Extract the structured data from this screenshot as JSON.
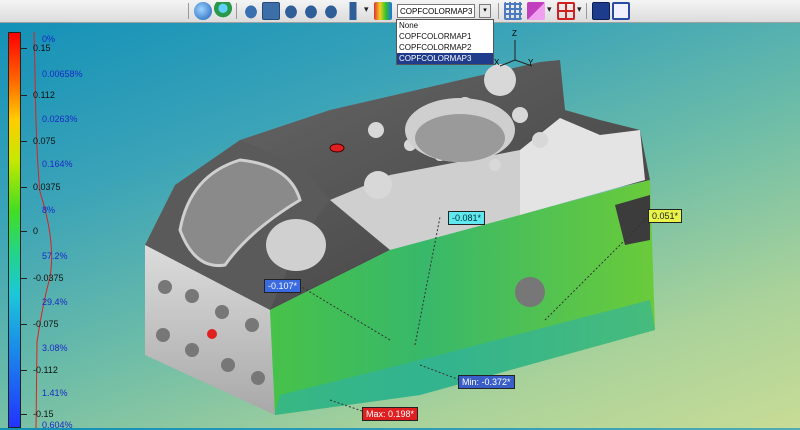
{
  "toolbar": {
    "combo_value": "COPFCOLORMAP3",
    "dropdown_options": [
      "None",
      "COPFCOLORMAP1",
      "COPFCOLORMAP2",
      "COPFCOLORMAP3"
    ],
    "selected_option": "COPFCOLORMAP3",
    "icons": [
      "globe-icon",
      "person-icon",
      "cloud-icon",
      "image-icon",
      "cloud-settings-icon",
      "cloud-sync-icon",
      "cloud-export-icon",
      "flag-icon",
      "colormap-icon",
      "grid-icon",
      "eraser-icon",
      "split-view-icon",
      "export-icon",
      "window-icon"
    ]
  },
  "colorbar": {
    "left_values": [
      "0.15",
      "0.112",
      "0.075",
      "0.0375",
      "0",
      "-0.0375",
      "-0.075",
      "-0.112",
      "-0.15"
    ],
    "right_values": [
      "0%",
      "0.00658%",
      "0.0263%",
      "0.164%",
      "8%",
      "57.2%",
      "29.4%",
      "3.08%",
      "1.41%",
      "0.604%"
    ],
    "colors": {
      "top": "#ff0000",
      "bottom": "#2233ff"
    }
  },
  "axes": {
    "z": "Z",
    "x": "X",
    "y": "Y"
  },
  "annotations": {
    "a1": "-0.081*",
    "a2": "0.051*",
    "a3": "-0.107*",
    "min": "Min: -0.372*",
    "max": "Max: 0.198*"
  }
}
